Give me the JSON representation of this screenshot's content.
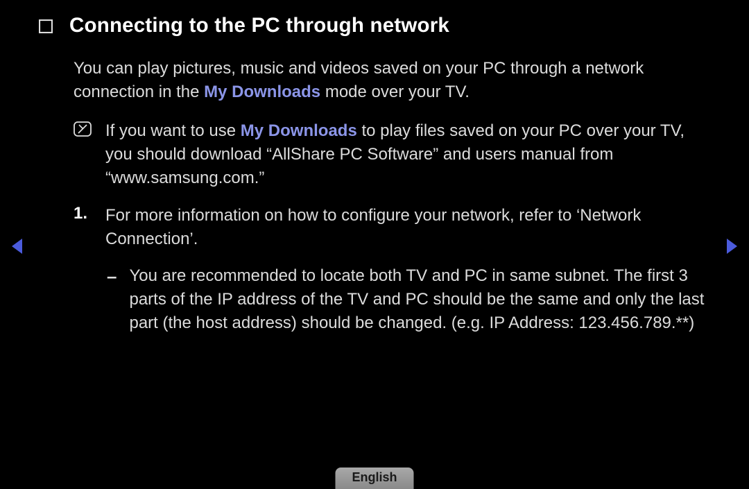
{
  "title": "Connecting to the PC through network",
  "intro": {
    "pre": "You can play pictures, music and videos saved on your PC through a network connection in the ",
    "highlight": "My Downloads",
    "post": " mode over your TV."
  },
  "note": {
    "pre": "If you want to use ",
    "highlight": "My Downloads",
    "post": " to play files saved on your PC over your TV, you should download “AllShare PC Software” and users manual from “www.samsung.com.”"
  },
  "step1": {
    "num": "1.",
    "text": "For more information on how to configure your network, refer to ‘Network Connection’."
  },
  "subitem": {
    "dash": "–",
    "text": "You are recommended to locate both TV and PC in same subnet. The first 3 parts of the IP address of the TV and PC should be the same and only the last part (the host address) should be changed. (e.g. IP Address: 123.456.789.**)"
  },
  "language": "English"
}
